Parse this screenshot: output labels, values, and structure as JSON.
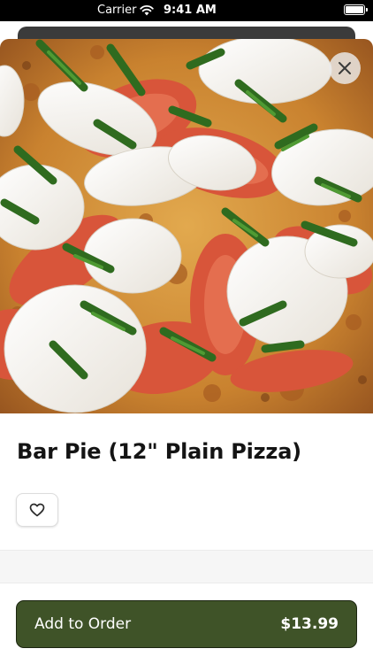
{
  "status_bar": {
    "carrier": "Carrier",
    "time": "9:41 AM"
  },
  "item": {
    "title": "Bar Pie (12\" Plain Pizza)",
    "image_alt": "Pizza topped with fresh mozzarella, sliced tomato and basil"
  },
  "actions": {
    "close_icon": "close-icon",
    "favorite_icon": "heart-outline-icon",
    "add_to_order_label": "Add to Order",
    "add_to_order_price": "$13.99"
  },
  "colors": {
    "primary_button": "#3f5328",
    "primary_button_border": "#1b2510",
    "button_text": "#ffffff",
    "title_text": "#141414"
  }
}
